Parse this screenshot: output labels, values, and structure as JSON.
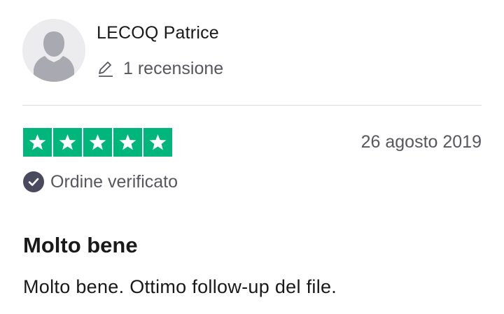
{
  "review": {
    "author": {
      "name": "LECOQ Patrice",
      "review_count": "1 recensione",
      "avatar_icon": "user-silhouette-icon",
      "count_icon": "pencil-icon"
    },
    "rating": {
      "stars": 5,
      "max_stars": 5,
      "star_color": "#00b67a",
      "star_icon": "star-icon"
    },
    "date": "26 agosto 2019",
    "verified": {
      "label": "Ordine verificato",
      "icon": "check-circle-icon",
      "icon_color": "#4a4a5e"
    },
    "title": "Molto bene",
    "text": "Molto bene. Ottimo follow-up del file."
  }
}
